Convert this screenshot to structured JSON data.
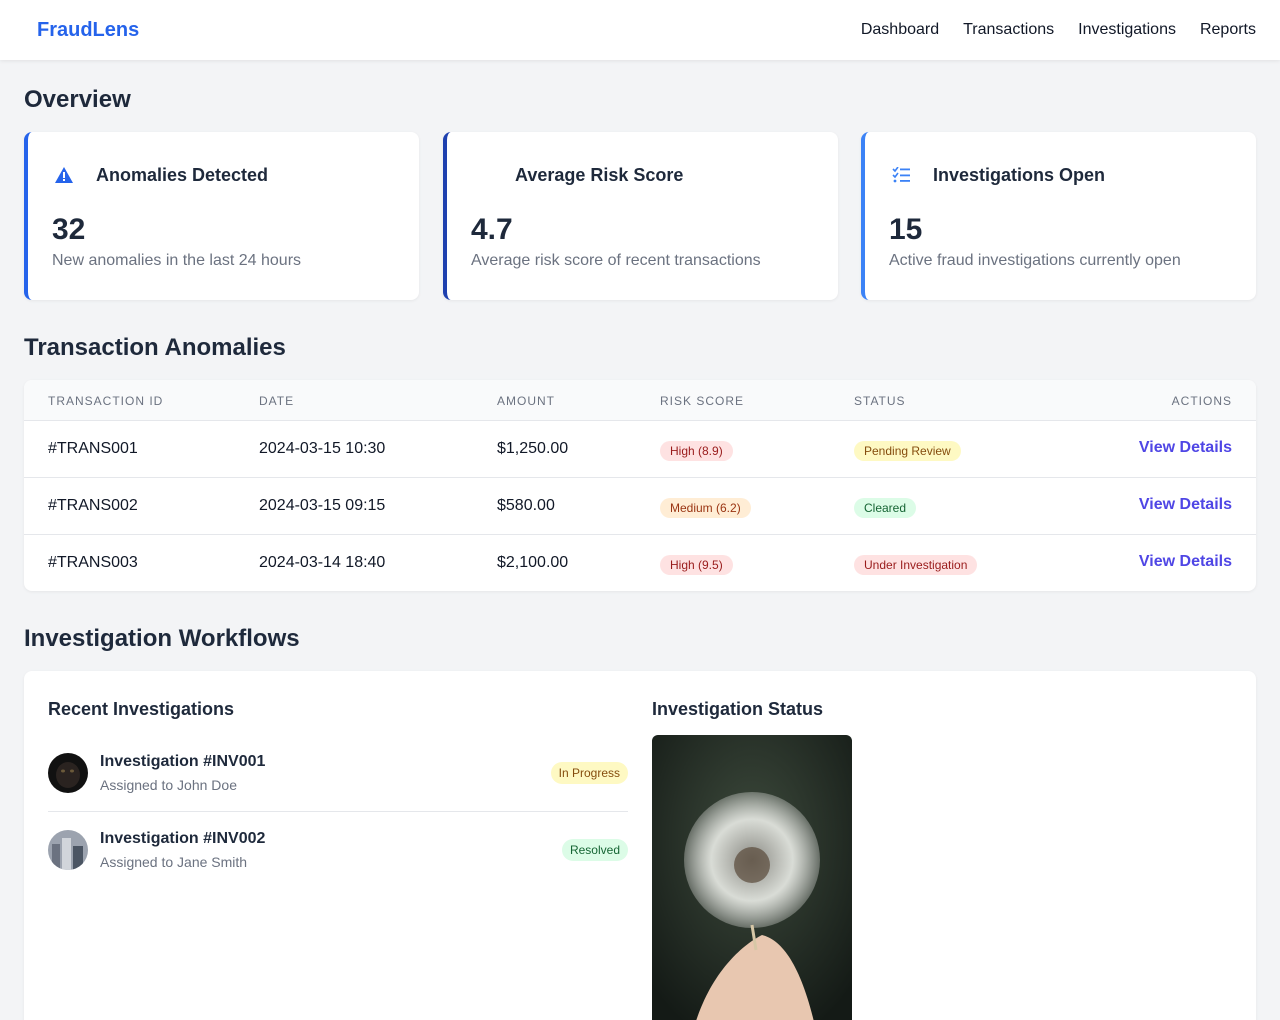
{
  "header": {
    "brand": "FraudLens",
    "nav": [
      "Dashboard",
      "Transactions",
      "Investigations",
      "Reports"
    ]
  },
  "overview": {
    "title": "Overview",
    "cards": [
      {
        "title": "Anomalies Detected",
        "value": "32",
        "desc": "New anomalies in the last 24 hours",
        "icon": "warning-icon",
        "accent": "#2563eb"
      },
      {
        "title": "Average Risk Score",
        "value": "4.7",
        "desc": "Average risk score of recent transactions",
        "icon": "chart-icon",
        "accent": "#1e40af"
      },
      {
        "title": "Investigations Open",
        "value": "15",
        "desc": "Active fraud investigations currently open",
        "icon": "tasks-icon",
        "accent": "#3b82f6"
      }
    ]
  },
  "anomalies": {
    "title": "Transaction Anomalies",
    "columns": [
      "TRANSACTION ID",
      "DATE",
      "AMOUNT",
      "RISK SCORE",
      "STATUS",
      "ACTIONS"
    ],
    "rows": [
      {
        "id": "#TRANS001",
        "date": "2024-03-15 10:30",
        "amount": "$1,250.00",
        "risk": "High (8.9)",
        "status": "Pending Review",
        "action": "View Details"
      },
      {
        "id": "#TRANS002",
        "date": "2024-03-15 09:15",
        "amount": "$580.00",
        "risk": "Medium (6.2)",
        "status": "Cleared",
        "action": "View Details"
      },
      {
        "id": "#TRANS003",
        "date": "2024-03-14 18:40",
        "amount": "$2,100.00",
        "risk": "High (9.5)",
        "status": "Under Investigation",
        "action": "View Details"
      }
    ]
  },
  "workflows": {
    "title": "Investigation Workflows",
    "recent_title": "Recent Investigations",
    "status_title": "Investigation Status",
    "items": [
      {
        "name": "Investigation #INV001",
        "assigned": "Assigned to John Doe",
        "status": "In Progress"
      },
      {
        "name": "Investigation #INV002",
        "assigned": "Assigned to Jane Smith",
        "status": "Resolved"
      }
    ]
  }
}
